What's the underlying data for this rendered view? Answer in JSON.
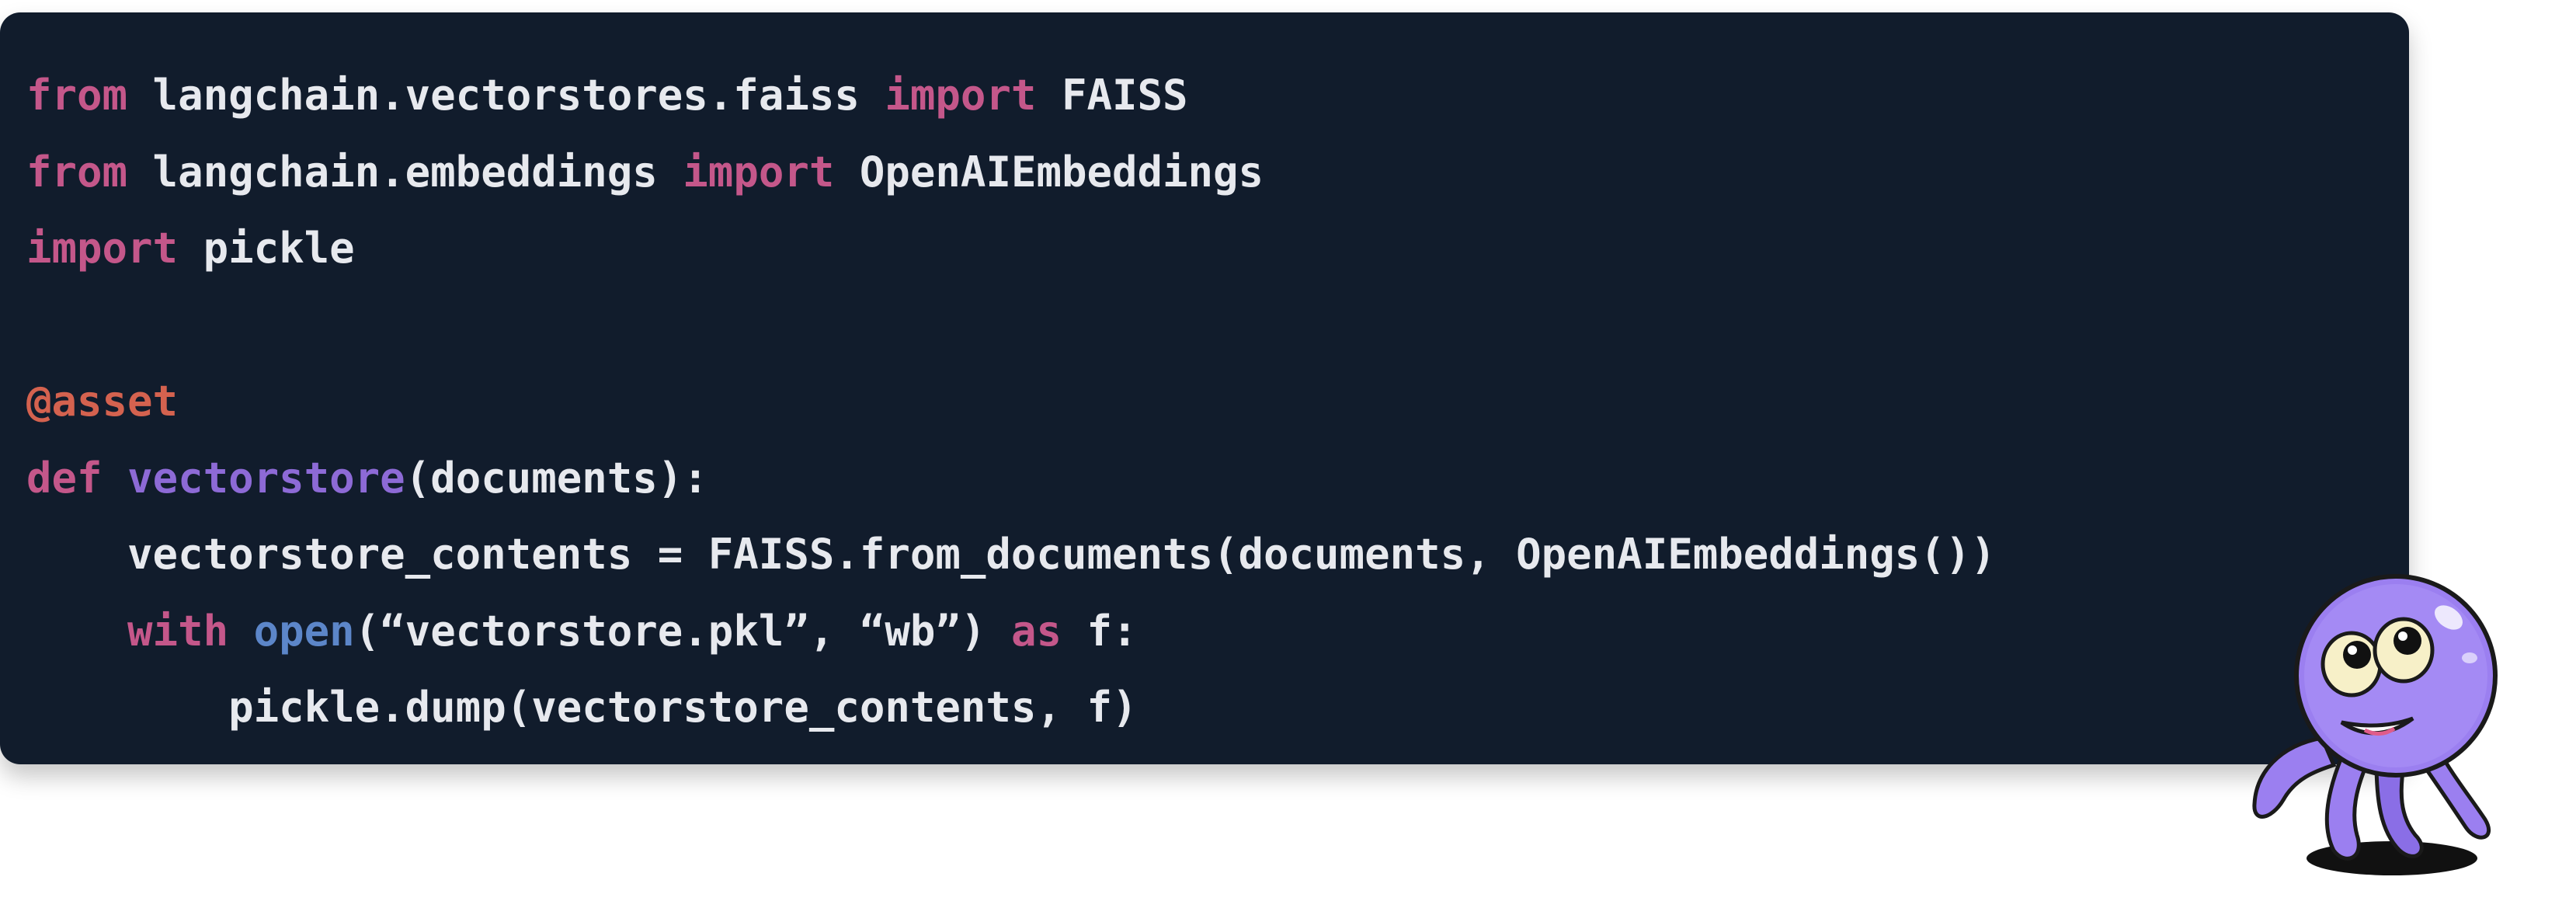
{
  "colors": {
    "background": "#111c2c",
    "keyword": "#c4578a",
    "decorator": "#d4624f",
    "function": "#8d6ad6",
    "builtin": "#5c86c9",
    "text": "#e7e9ee",
    "mascot_body": "#9b7ff0"
  },
  "code": {
    "lines": [
      [
        {
          "t": "from",
          "k": "kw"
        },
        {
          "t": " langchain.vectorstores.faiss ",
          "k": "plain"
        },
        {
          "t": "import",
          "k": "kw"
        },
        {
          "t": " FAISS",
          "k": "plain"
        }
      ],
      [
        {
          "t": "from",
          "k": "kw"
        },
        {
          "t": " langchain.embeddings ",
          "k": "plain"
        },
        {
          "t": "import",
          "k": "kw"
        },
        {
          "t": " OpenAIEmbeddings",
          "k": "plain"
        }
      ],
      [
        {
          "t": "import",
          "k": "kw"
        },
        {
          "t": " pickle",
          "k": "plain"
        }
      ],
      [],
      [
        {
          "t": "@asset",
          "k": "dec"
        }
      ],
      [
        {
          "t": "def",
          "k": "kw"
        },
        {
          "t": " ",
          "k": "plain"
        },
        {
          "t": "vectorstore",
          "k": "fn"
        },
        {
          "t": "(documents):",
          "k": "plain"
        }
      ],
      [
        {
          "t": "    vectorstore_contents = FAISS.from_documents(documents, OpenAIEmbeddings())",
          "k": "plain"
        }
      ],
      [
        {
          "t": "    ",
          "k": "plain"
        },
        {
          "t": "with",
          "k": "kw"
        },
        {
          "t": " ",
          "k": "plain"
        },
        {
          "t": "open",
          "k": "bi"
        },
        {
          "t": "(“vectorstore.pkl”, “wb”) ",
          "k": "plain"
        },
        {
          "t": "as",
          "k": "kw"
        },
        {
          "t": " f:",
          "k": "plain"
        }
      ],
      [
        {
          "t": "        pickle.dump(vectorstore_contents, f)",
          "k": "plain"
        }
      ]
    ]
  },
  "mascot": {
    "icon": "octopus-mascot-icon"
  }
}
